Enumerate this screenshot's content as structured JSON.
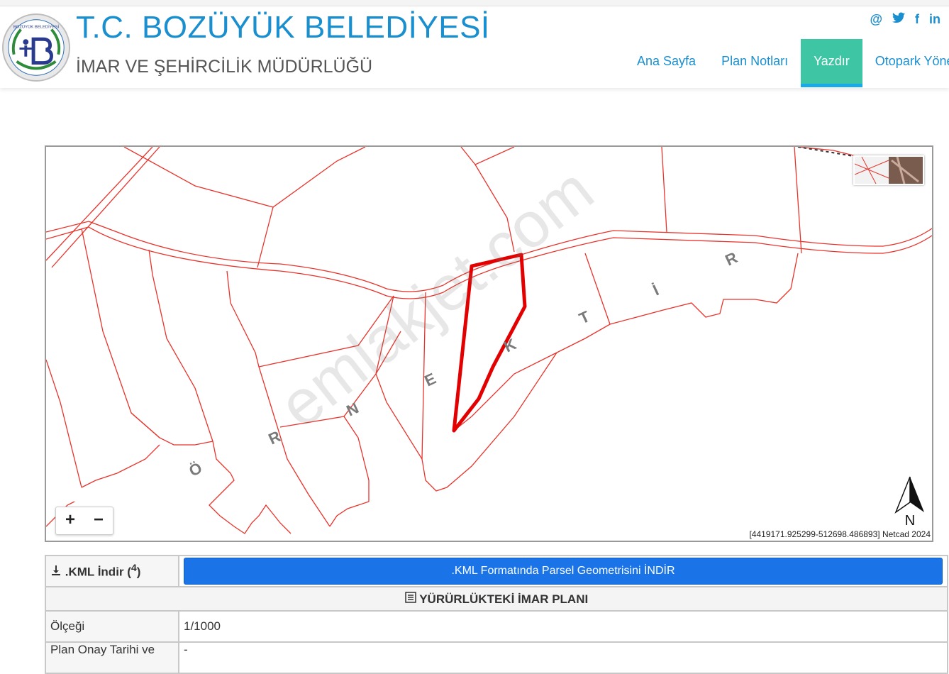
{
  "header": {
    "title": "T.C. BOZÜYÜK BELEDİYESİ",
    "subtitle": "İMAR VE ŞEHİRCİLİK MÜDÜRLÜĞÜ",
    "logo_text": "BOZÜYÜK BELEDİYESİ",
    "social": [
      "@",
      "🐦",
      "f",
      "in"
    ],
    "nav": [
      {
        "label": "Ana Sayfa",
        "active": false
      },
      {
        "label": "Plan Notları",
        "active": false
      },
      {
        "label": "Yazdır",
        "active": true
      },
      {
        "label": "Otopark Yöne",
        "active": false
      }
    ]
  },
  "map": {
    "zoom_in": "+",
    "zoom_out": "−",
    "north_label": "N",
    "coordinates": "[4419171.925299-512698.486893] Netcad 2024",
    "watermark": "emlakjet.com",
    "street_letters": [
      "Ö",
      "R",
      "N",
      "E",
      "K",
      "T",
      "İ",
      "R"
    ],
    "parcel_color": "#e8332b",
    "highlight_color": "#e20000"
  },
  "table": {
    "kml_label": ".KML İndir (",
    "kml_sup": "4",
    "kml_close": ")",
    "kml_button": ".KML Formatında Parsel Geometrisini İNDİR",
    "section_title": "YÜRÜRLÜKTEKİ İMAR PLANI",
    "rows": [
      {
        "label": "Ölçeği",
        "value": "1/1000"
      },
      {
        "label": "Plan Onay Tarihi ve",
        "value": "-"
      }
    ]
  }
}
